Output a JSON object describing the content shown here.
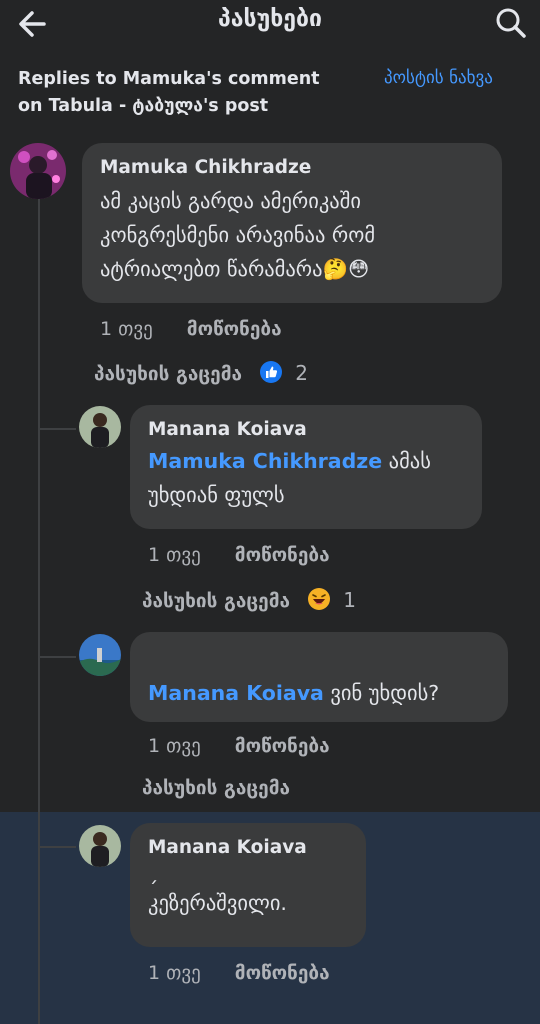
{
  "header": {
    "title": "პასუხები",
    "back_icon": "arrow-left-icon",
    "search_icon": "search-icon"
  },
  "context": {
    "text": "Replies to Mamuka's comment on Tabula - ტაბულა's post",
    "view_post_label": "პოსტის ნახვა"
  },
  "colors": {
    "background": "#242526",
    "bubble": "#3a3b3c",
    "link": "#4599ff",
    "highlight": "#263345"
  },
  "comments": [
    {
      "author": "Mamuka Chikhradze",
      "lines": [
        "ამ კაცის გარდა ამერიკაში",
        "კონგრესმენი არავინაა რომ",
        "ატრიალებთ წარამარა🤔😳"
      ],
      "time": "1 თვე",
      "like_label": "მოწონება",
      "reply_label": "პასუხის გაცემა",
      "reaction_icon": "like-icon",
      "reaction_count": "2"
    },
    {
      "author": "Manana Koiava",
      "mention": "Mamuka Chikhradze",
      "line1_rest": " ამას",
      "line2": "უხდიან ფულს",
      "time": "1 თვე",
      "like_label": "მოწონება",
      "reply_label": "პასუხის გაცემა",
      "reaction_icon": "haha-icon",
      "reaction_count": "1"
    },
    {
      "mention": "Manana Koiava",
      "rest": " ვინ უხდის?",
      "time": "1 თვე",
      "like_label": "მოწონება",
      "reply_label": "პასუხის გაცემა"
    },
    {
      "author": "Manana Koiava",
      "line1": "ˏ",
      "line2": "კეზერაშვილი.",
      "time": "1 თვე",
      "like_label": "მოწონება"
    }
  ]
}
